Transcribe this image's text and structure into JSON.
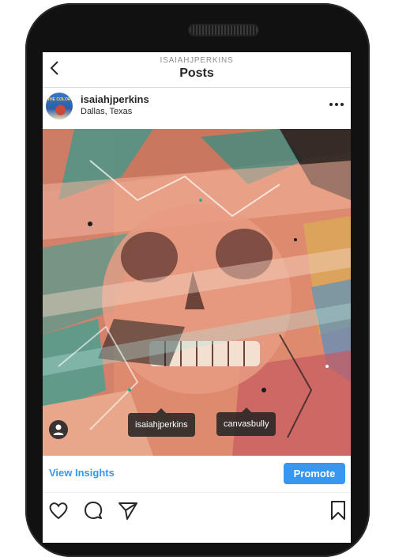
{
  "nav": {
    "account_name": "ISAIAHJPERKINS",
    "title": "Posts",
    "back_icon": "chevron-left-icon"
  },
  "post": {
    "username": "isaiahjperkins",
    "location": "Dallas, Texas",
    "avatar_text": "THE COLOR",
    "more_icon": "more-dots-icon",
    "image_subject": "painted skull artwork",
    "tags": [
      "isaiahjperkins",
      "canvasbully"
    ],
    "tagged_icon": "person-icon"
  },
  "insights": {
    "view_label": "View Insights",
    "promote_label": "Promote",
    "accent_color": "#3897f0"
  },
  "actions": {
    "icons": [
      "heart-icon",
      "comment-icon",
      "share-icon",
      "bookmark-icon"
    ]
  }
}
